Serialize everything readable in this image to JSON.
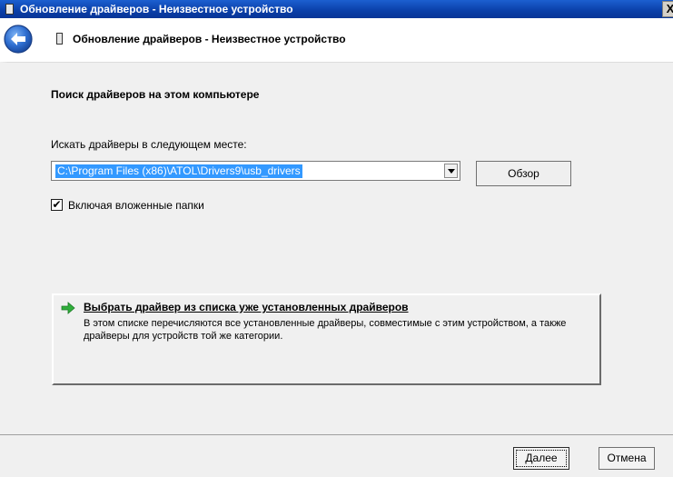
{
  "window": {
    "title": "Обновление драйверов - Неизвестное устройство",
    "close_label": "X"
  },
  "header": {
    "title": "Обновление драйверов - Неизвестное устройство"
  },
  "main": {
    "section_title": "Поиск драйверов на этом компьютере",
    "search_label": "Искать драйверы в следующем месте:",
    "path_value": "C:\\Program Files (x86)\\ATOL\\Drivers9\\usb_drivers",
    "browse_label": "Обзор",
    "include_subfolders": {
      "label": "Включая вложенные папки",
      "checked": true,
      "check_glyph": "✔"
    },
    "pick_option": {
      "title": "Выбрать драйвер из списка уже установленных драйверов",
      "description": "В этом списке перечисляются все установленные драйверы, совместимые с этим устройством, а также драйверы для устройств той же категории."
    }
  },
  "footer": {
    "next_label": "Далее",
    "cancel_label": "Отмена"
  },
  "colors": {
    "titlebar": "#0a3fa8",
    "selection": "#3399ff",
    "back_button": "#2f6fd1",
    "arrow_icon": "#2fae3b",
    "panel_bg": "#f0f0f0"
  }
}
